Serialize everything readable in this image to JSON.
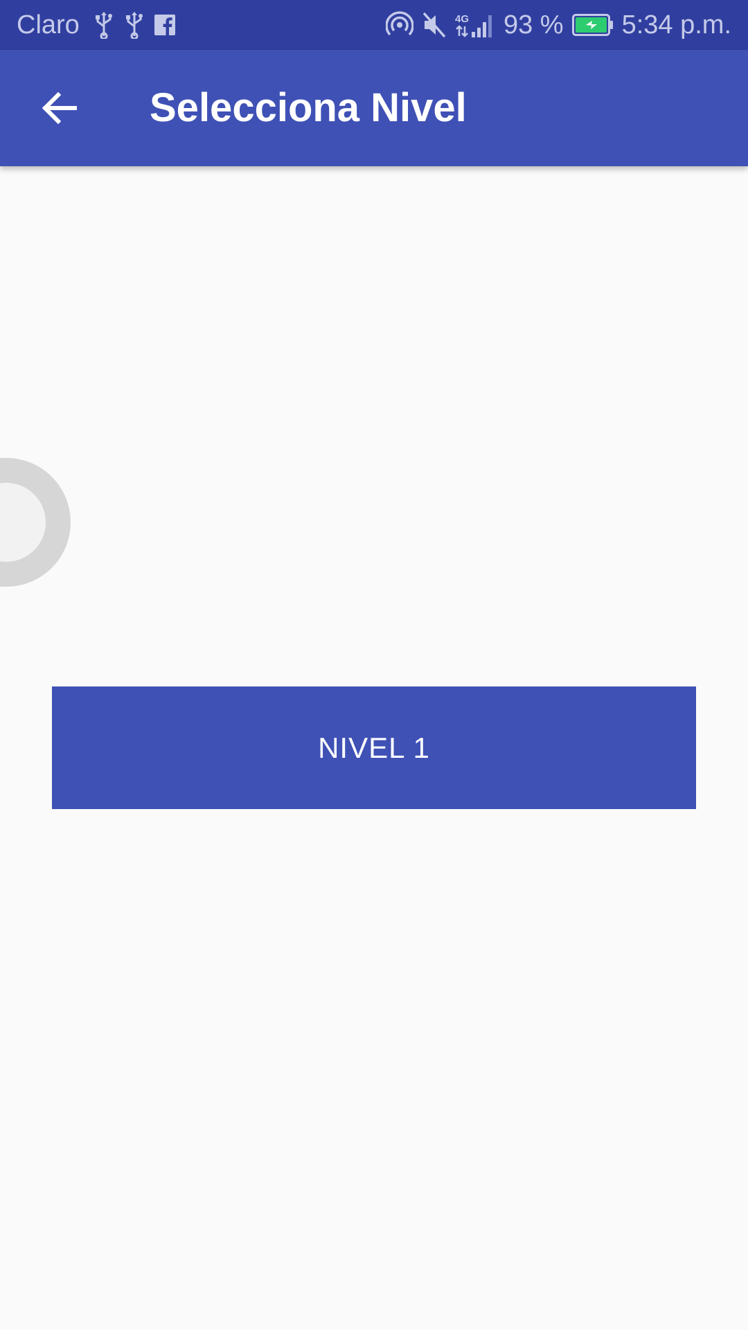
{
  "status_bar": {
    "carrier": "Claro",
    "network_label": "4G",
    "battery_percent": "93 %",
    "time": "5:34 p.m.",
    "icons": [
      "usb-icon",
      "usb-icon",
      "facebook-icon",
      "hotspot-icon",
      "mute-icon",
      "signal-icon",
      "battery-charging-icon"
    ],
    "colors": {
      "background": "#303f9f",
      "text": "#c5cae9",
      "battery_fill": "#2ecc71"
    }
  },
  "app_bar": {
    "title": "Selecciona Nivel",
    "back_icon": "arrow-back-icon",
    "background": "#3f51b5"
  },
  "main": {
    "level_button_label": "NIVEL 1",
    "button_color": "#3f51b5",
    "background": "#fafafa"
  }
}
